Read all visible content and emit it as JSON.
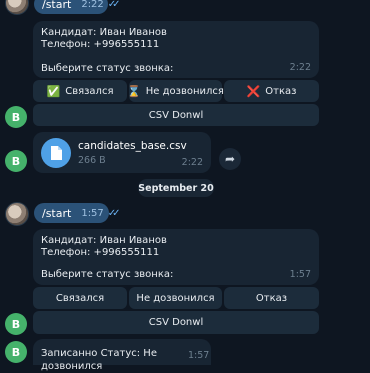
{
  "messages": {
    "start_label": "/start",
    "start1_time": "2:22",
    "start2_time": "1:57",
    "card1": {
      "line1": "Кандидат: Иван Иванов",
      "line2": "Телефон: +996555111",
      "line3": "Выберите статус звонка:",
      "time": "2:22"
    },
    "card2": {
      "line1": "Кандидат: Иван Иванов",
      "line2": "Телефон: +996555111",
      "line3": "Выберите статус звонка:",
      "time": "1:57"
    },
    "file": {
      "name": "candidates_base.csv",
      "size": "266 B",
      "time": "2:22"
    },
    "date_separator": "September 20",
    "final": {
      "text": "Записанно Статус: Не дозвонился",
      "time": "1:57"
    }
  },
  "keyboard1": {
    "connected": "Связался",
    "connected_emoji": "✅",
    "no_answer": "Не дозвонился",
    "no_answer_emoji": "⌛",
    "refusal": "Отказ",
    "refusal_emoji": "❌",
    "csv": "CSV Donwl"
  },
  "keyboard2": {
    "connected": "Связался",
    "no_answer": "Не дозвонился",
    "refusal": "Отказ",
    "csv": "CSV Donwl"
  },
  "avatar_letter": "B",
  "colors": {
    "background": "#0e1621",
    "outgoing": "#2b5278",
    "incoming": "#182533",
    "button": "#1c2c3b",
    "avatar": "#45b26b",
    "file_icon": "#4fa1e7"
  }
}
